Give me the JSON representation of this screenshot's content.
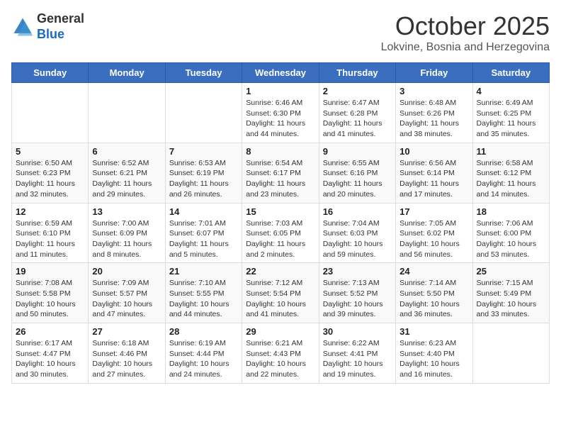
{
  "header": {
    "logo_general": "General",
    "logo_blue": "Blue",
    "month_title": "October 2025",
    "subtitle": "Lokvine, Bosnia and Herzegovina"
  },
  "weekdays": [
    "Sunday",
    "Monday",
    "Tuesday",
    "Wednesday",
    "Thursday",
    "Friday",
    "Saturday"
  ],
  "weeks": [
    [
      {
        "day": "",
        "info": ""
      },
      {
        "day": "",
        "info": ""
      },
      {
        "day": "",
        "info": ""
      },
      {
        "day": "1",
        "info": "Sunrise: 6:46 AM\nSunset: 6:30 PM\nDaylight: 11 hours and 44 minutes."
      },
      {
        "day": "2",
        "info": "Sunrise: 6:47 AM\nSunset: 6:28 PM\nDaylight: 11 hours and 41 minutes."
      },
      {
        "day": "3",
        "info": "Sunrise: 6:48 AM\nSunset: 6:26 PM\nDaylight: 11 hours and 38 minutes."
      },
      {
        "day": "4",
        "info": "Sunrise: 6:49 AM\nSunset: 6:25 PM\nDaylight: 11 hours and 35 minutes."
      }
    ],
    [
      {
        "day": "5",
        "info": "Sunrise: 6:50 AM\nSunset: 6:23 PM\nDaylight: 11 hours and 32 minutes."
      },
      {
        "day": "6",
        "info": "Sunrise: 6:52 AM\nSunset: 6:21 PM\nDaylight: 11 hours and 29 minutes."
      },
      {
        "day": "7",
        "info": "Sunrise: 6:53 AM\nSunset: 6:19 PM\nDaylight: 11 hours and 26 minutes."
      },
      {
        "day": "8",
        "info": "Sunrise: 6:54 AM\nSunset: 6:17 PM\nDaylight: 11 hours and 23 minutes."
      },
      {
        "day": "9",
        "info": "Sunrise: 6:55 AM\nSunset: 6:16 PM\nDaylight: 11 hours and 20 minutes."
      },
      {
        "day": "10",
        "info": "Sunrise: 6:56 AM\nSunset: 6:14 PM\nDaylight: 11 hours and 17 minutes."
      },
      {
        "day": "11",
        "info": "Sunrise: 6:58 AM\nSunset: 6:12 PM\nDaylight: 11 hours and 14 minutes."
      }
    ],
    [
      {
        "day": "12",
        "info": "Sunrise: 6:59 AM\nSunset: 6:10 PM\nDaylight: 11 hours and 11 minutes."
      },
      {
        "day": "13",
        "info": "Sunrise: 7:00 AM\nSunset: 6:09 PM\nDaylight: 11 hours and 8 minutes."
      },
      {
        "day": "14",
        "info": "Sunrise: 7:01 AM\nSunset: 6:07 PM\nDaylight: 11 hours and 5 minutes."
      },
      {
        "day": "15",
        "info": "Sunrise: 7:03 AM\nSunset: 6:05 PM\nDaylight: 11 hours and 2 minutes."
      },
      {
        "day": "16",
        "info": "Sunrise: 7:04 AM\nSunset: 6:03 PM\nDaylight: 10 hours and 59 minutes."
      },
      {
        "day": "17",
        "info": "Sunrise: 7:05 AM\nSunset: 6:02 PM\nDaylight: 10 hours and 56 minutes."
      },
      {
        "day": "18",
        "info": "Sunrise: 7:06 AM\nSunset: 6:00 PM\nDaylight: 10 hours and 53 minutes."
      }
    ],
    [
      {
        "day": "19",
        "info": "Sunrise: 7:08 AM\nSunset: 5:58 PM\nDaylight: 10 hours and 50 minutes."
      },
      {
        "day": "20",
        "info": "Sunrise: 7:09 AM\nSunset: 5:57 PM\nDaylight: 10 hours and 47 minutes."
      },
      {
        "day": "21",
        "info": "Sunrise: 7:10 AM\nSunset: 5:55 PM\nDaylight: 10 hours and 44 minutes."
      },
      {
        "day": "22",
        "info": "Sunrise: 7:12 AM\nSunset: 5:54 PM\nDaylight: 10 hours and 41 minutes."
      },
      {
        "day": "23",
        "info": "Sunrise: 7:13 AM\nSunset: 5:52 PM\nDaylight: 10 hours and 39 minutes."
      },
      {
        "day": "24",
        "info": "Sunrise: 7:14 AM\nSunset: 5:50 PM\nDaylight: 10 hours and 36 minutes."
      },
      {
        "day": "25",
        "info": "Sunrise: 7:15 AM\nSunset: 5:49 PM\nDaylight: 10 hours and 33 minutes."
      }
    ],
    [
      {
        "day": "26",
        "info": "Sunrise: 6:17 AM\nSunset: 4:47 PM\nDaylight: 10 hours and 30 minutes."
      },
      {
        "day": "27",
        "info": "Sunrise: 6:18 AM\nSunset: 4:46 PM\nDaylight: 10 hours and 27 minutes."
      },
      {
        "day": "28",
        "info": "Sunrise: 6:19 AM\nSunset: 4:44 PM\nDaylight: 10 hours and 24 minutes."
      },
      {
        "day": "29",
        "info": "Sunrise: 6:21 AM\nSunset: 4:43 PM\nDaylight: 10 hours and 22 minutes."
      },
      {
        "day": "30",
        "info": "Sunrise: 6:22 AM\nSunset: 4:41 PM\nDaylight: 10 hours and 19 minutes."
      },
      {
        "day": "31",
        "info": "Sunrise: 6:23 AM\nSunset: 4:40 PM\nDaylight: 10 hours and 16 minutes."
      },
      {
        "day": "",
        "info": ""
      }
    ]
  ]
}
